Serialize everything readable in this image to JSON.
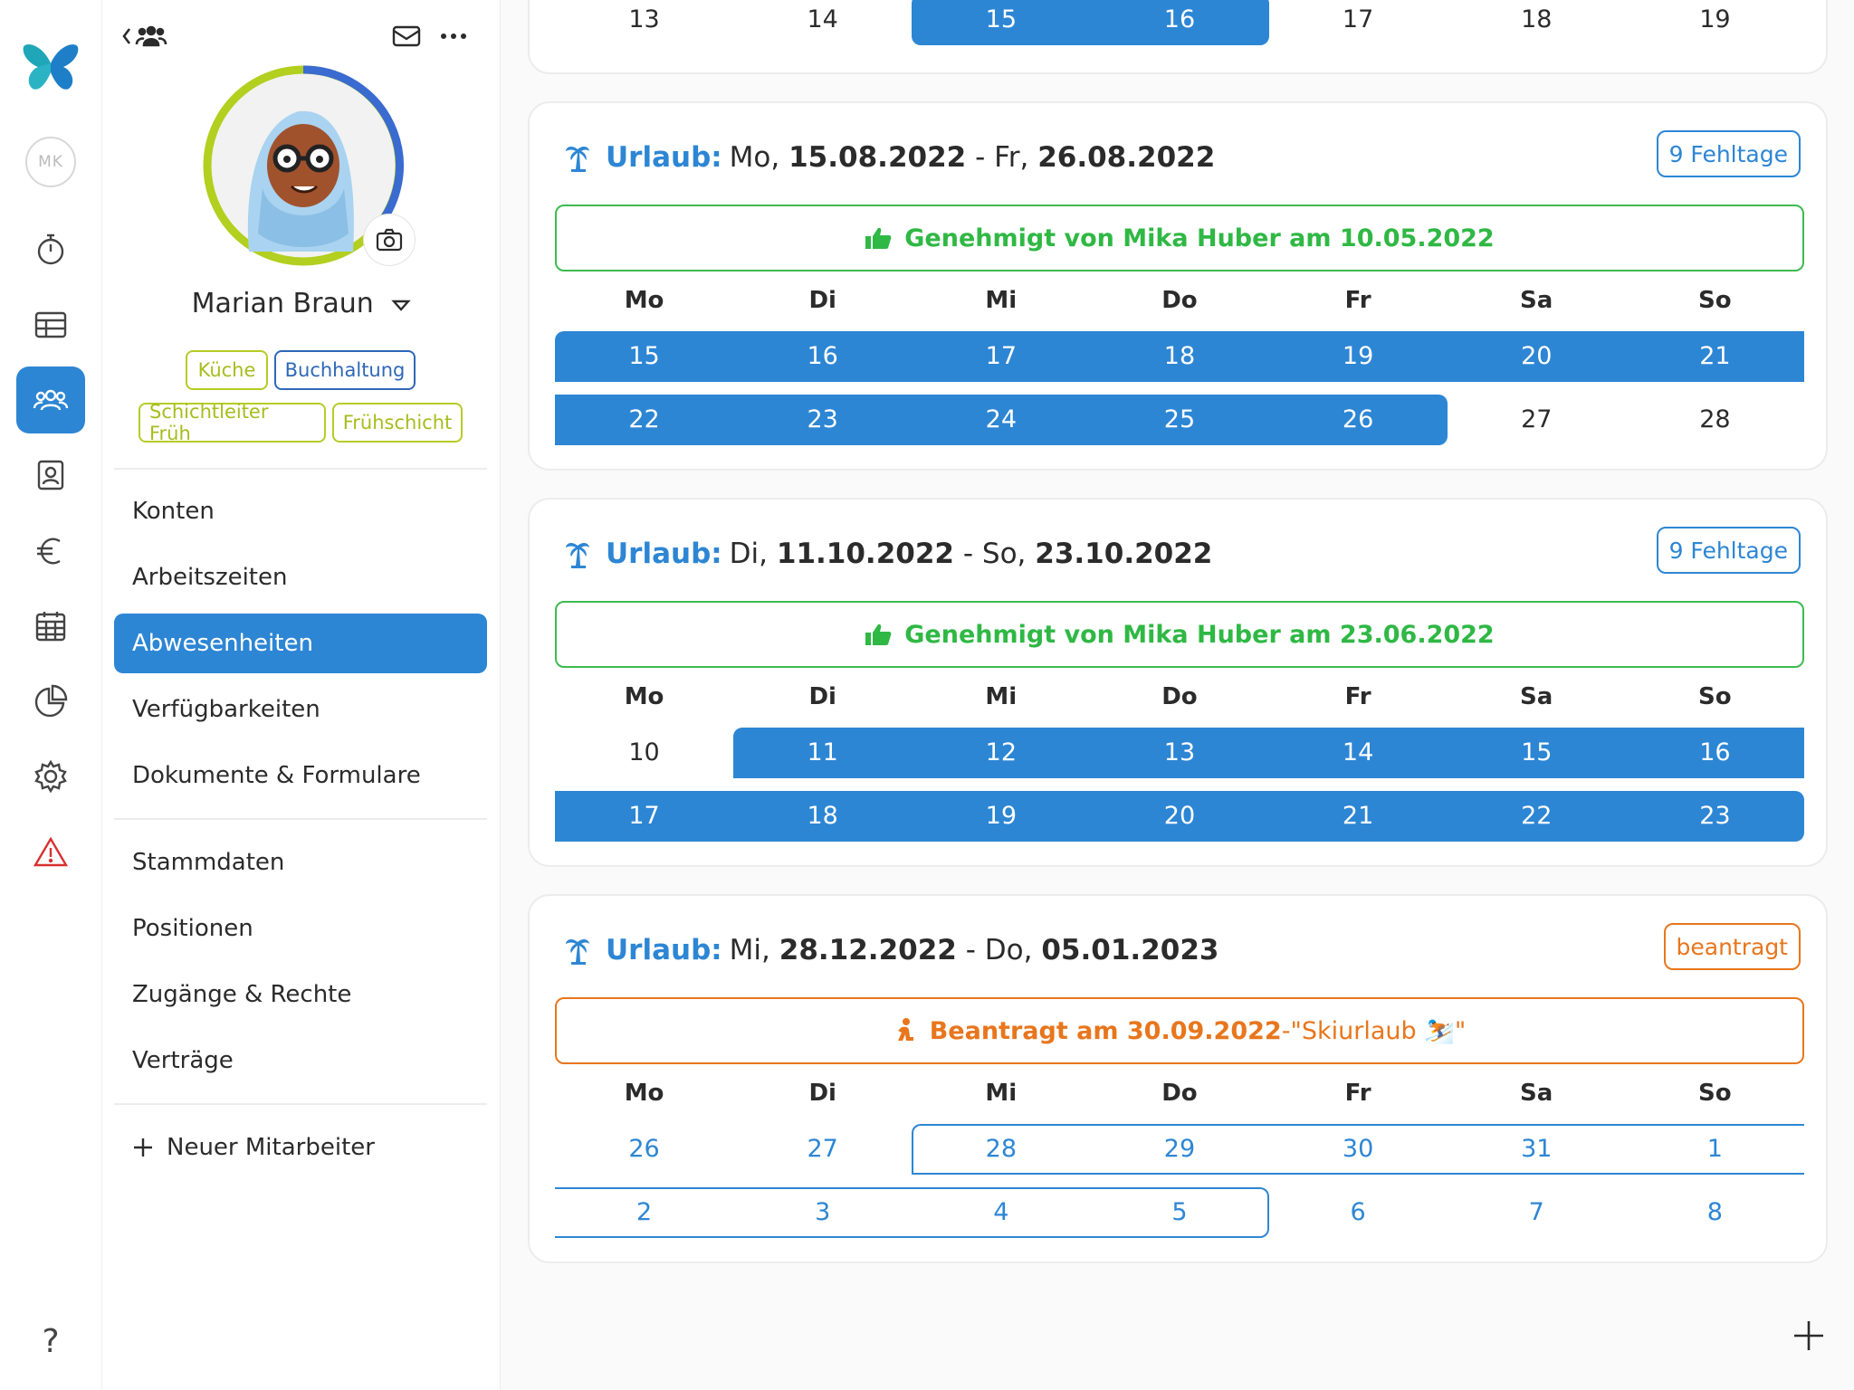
{
  "rail": {
    "user_initials": "MK",
    "items": [
      {
        "icon": "stopwatch-icon"
      },
      {
        "icon": "table-icon"
      },
      {
        "icon": "people-icon",
        "active": true
      },
      {
        "icon": "contact-card-icon"
      },
      {
        "icon": "euro-icon"
      },
      {
        "icon": "calendar-icon"
      },
      {
        "icon": "pie-chart-icon"
      },
      {
        "icon": "settings-gear-icon"
      },
      {
        "icon": "warning-icon"
      }
    ],
    "help": "?"
  },
  "profile": {
    "name": "Marian Braun",
    "tags": [
      "Küche",
      "Buchhaltung",
      "Schichtleiter Früh",
      "Frühschicht"
    ]
  },
  "menu": {
    "group1": [
      "Konten",
      "Arbeitszeiten",
      "Abwesenheiten",
      "Verfügbarkeiten",
      "Dokumente & Formulare"
    ],
    "group2": [
      "Stammdaten",
      "Positionen",
      "Zugänge & Rechte",
      "Verträge"
    ],
    "new_employee": "Neuer Mitarbeiter",
    "active": "Abwesenheiten"
  },
  "partial_week": [
    "13",
    "14",
    "15",
    "16",
    "17",
    "18",
    "19"
  ],
  "weekdays": [
    "Mo",
    "Di",
    "Mi",
    "Do",
    "Fr",
    "Sa",
    "So"
  ],
  "absences": [
    {
      "kind": "Urlaub:",
      "start_day": "Mo,",
      "start_date": "15.08.2022",
      "sep": "-",
      "end_day": "Fr,",
      "end_date": "26.08.2022",
      "badge": "9 Fehltage",
      "status": "Genehmigt von Mika Huber am 10.05.2022",
      "weeks": [
        [
          "15",
          "16",
          "17",
          "18",
          "19",
          "20",
          "21"
        ],
        [
          "22",
          "23",
          "24",
          "25",
          "26",
          "27",
          "28"
        ]
      ]
    },
    {
      "kind": "Urlaub:",
      "start_day": "Di,",
      "start_date": "11.10.2022",
      "sep": "-",
      "end_day": "So,",
      "end_date": "23.10.2022",
      "badge": "9 Fehltage",
      "status": "Genehmigt von Mika Huber am 23.06.2022",
      "weeks": [
        [
          "10",
          "11",
          "12",
          "13",
          "14",
          "15",
          "16"
        ],
        [
          "17",
          "18",
          "19",
          "20",
          "21",
          "22",
          "23"
        ]
      ]
    },
    {
      "kind": "Urlaub:",
      "start_day": "Mi,",
      "start_date": "28.12.2022",
      "sep": "-",
      "end_day": "Do,",
      "end_date": "05.01.2023",
      "badge": "beantragt",
      "status": "Beantragt am 30.09.2022",
      "status_sep": " - ",
      "status_note": "\"Skiurlaub ⛷️\"",
      "weeks": [
        [
          "26",
          "27",
          "28",
          "29",
          "30",
          "31",
          "1"
        ],
        [
          "2",
          "3",
          "4",
          "5",
          "6",
          "7",
          "8"
        ]
      ]
    }
  ],
  "colors": {
    "accent": "#2d86d4",
    "approved": "#2fb844",
    "requested": "#e8761d",
    "tag_green": "#a7bd1d",
    "tag_blue": "#2e67b8"
  }
}
